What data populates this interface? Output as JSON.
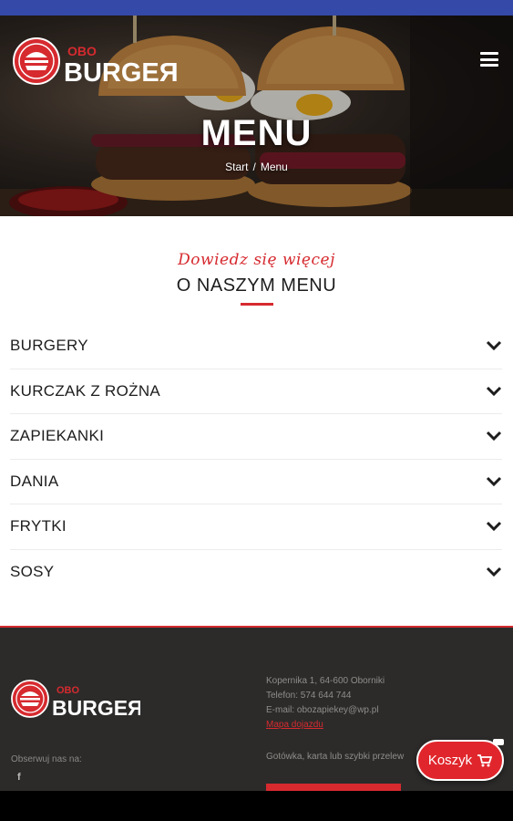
{
  "header": {
    "logo_small": "OBO",
    "logo_big": "BURGEЯ",
    "title": "MENU",
    "breadcrumb": [
      "Start",
      "/",
      "Menu"
    ]
  },
  "intro": {
    "script_text": "Dowiedz się więcej",
    "title": "O NASZYM MENU"
  },
  "menu_categories": [
    {
      "label": "BURGERY",
      "icon": "chevron-down-icon"
    },
    {
      "label": "KURCZAK Z ROŻNA",
      "icon": "chevron-down-icon"
    },
    {
      "label": "ZAPIEKANKI",
      "icon": "chevron-down-icon"
    },
    {
      "label": "DANIA",
      "icon": "chevron-down-icon"
    },
    {
      "label": "FRYTKI",
      "icon": "chevron-down-icon"
    },
    {
      "label": "SOSY",
      "icon": "chevron-down-icon"
    }
  ],
  "footer": {
    "logo_small": "OBO",
    "logo_big": "BURGEЯ",
    "follow_label": "Obserwuj nas na:",
    "social_icon": "f",
    "address": "Kopernika 1, 64-600 Oborniki",
    "phone": "Telefon: 574 644 744",
    "email": "E-mail: obozapiekey@wp.pl",
    "map_link": "Mapa dojazdu",
    "payment": "Gotówka, karta lub szybki przelew"
  },
  "cart": {
    "label": "Koszyk",
    "icon": "cart-icon"
  },
  "colors": {
    "accent": "#d62a2f",
    "status_bar": "#3549a8",
    "footer_bg": "#2c2b2a"
  }
}
